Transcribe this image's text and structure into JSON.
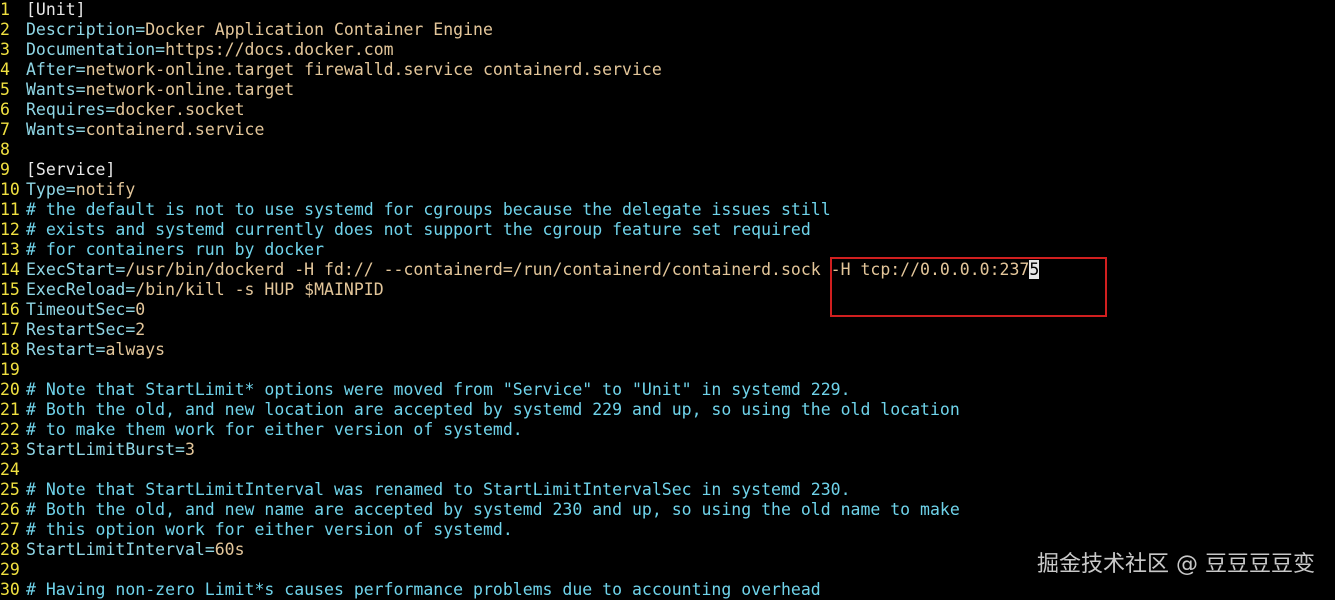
{
  "colors": {
    "background": "#000000",
    "line_number": "#f0e040",
    "key": "#8fd7e6",
    "value": "#e3c69a",
    "section": "#e8e8e8",
    "comment": "#6fd3ea",
    "highlight_box": "#d11f1f"
  },
  "lines": [
    {
      "n": "1",
      "type": "sec",
      "text": "[Unit]"
    },
    {
      "n": "2",
      "type": "kv",
      "key": "Description",
      "value": "Docker Application Container Engine"
    },
    {
      "n": "3",
      "type": "kv",
      "key": "Documentation",
      "value": "https://docs.docker.com"
    },
    {
      "n": "4",
      "type": "kv",
      "key": "After",
      "value": "network-online.target firewalld.service containerd.service"
    },
    {
      "n": "5",
      "type": "kv",
      "key": "Wants",
      "value": "network-online.target"
    },
    {
      "n": "6",
      "type": "kv",
      "key": "Requires",
      "value": "docker.socket"
    },
    {
      "n": "7",
      "type": "kv",
      "key": "Wants",
      "value": "containerd.service"
    },
    {
      "n": "8",
      "type": "blank"
    },
    {
      "n": "9",
      "type": "sec",
      "text": "[Service]"
    },
    {
      "n": "10",
      "type": "kv",
      "key": "Type",
      "value": "notify"
    },
    {
      "n": "11",
      "type": "cmt",
      "text": "# the default is not to use systemd for cgroups because the delegate issues still"
    },
    {
      "n": "12",
      "type": "cmt",
      "text": "# exists and systemd currently does not support the cgroup feature set required"
    },
    {
      "n": "13",
      "type": "cmt",
      "text": "# for containers run by docker"
    },
    {
      "n": "14",
      "type": "kv",
      "key": "ExecStart",
      "value": "/usr/bin/dockerd -H fd:// --containerd=/run/containerd/containerd.sock -H tcp://0.0.0.0:237",
      "cursor": "5"
    },
    {
      "n": "15",
      "type": "kv",
      "key": "ExecReload",
      "value": "/bin/kill -s HUP $MAINPID"
    },
    {
      "n": "16",
      "type": "kv",
      "key": "TimeoutSec",
      "value": "0"
    },
    {
      "n": "17",
      "type": "kv",
      "key": "RestartSec",
      "value": "2"
    },
    {
      "n": "18",
      "type": "kv",
      "key": "Restart",
      "value": "always"
    },
    {
      "n": "19",
      "type": "blank"
    },
    {
      "n": "20",
      "type": "cmt",
      "text": "# Note that StartLimit* options were moved from \"Service\" to \"Unit\" in systemd 229."
    },
    {
      "n": "21",
      "type": "cmt",
      "text": "# Both the old, and new location are accepted by systemd 229 and up, so using the old location"
    },
    {
      "n": "22",
      "type": "cmt",
      "text": "# to make them work for either version of systemd."
    },
    {
      "n": "23",
      "type": "kv",
      "key": "StartLimitBurst",
      "value": "3"
    },
    {
      "n": "24",
      "type": "blank"
    },
    {
      "n": "25",
      "type": "cmt",
      "text": "# Note that StartLimitInterval was renamed to StartLimitIntervalSec in systemd 230."
    },
    {
      "n": "26",
      "type": "cmt",
      "text": "# Both the old, and new name are accepted by systemd 230 and up, so using the old name to make"
    },
    {
      "n": "27",
      "type": "cmt",
      "text": "# this option work for either version of systemd."
    },
    {
      "n": "28",
      "type": "kv",
      "key": "StartLimitInterval",
      "value": "60s"
    },
    {
      "n": "29",
      "type": "blank"
    },
    {
      "n": "30",
      "type": "cmt",
      "text": "# Having non-zero Limit*s causes performance problems due to accounting overhead"
    }
  ],
  "watermark": "掘金技术社区 @ 豆豆豆豆变"
}
